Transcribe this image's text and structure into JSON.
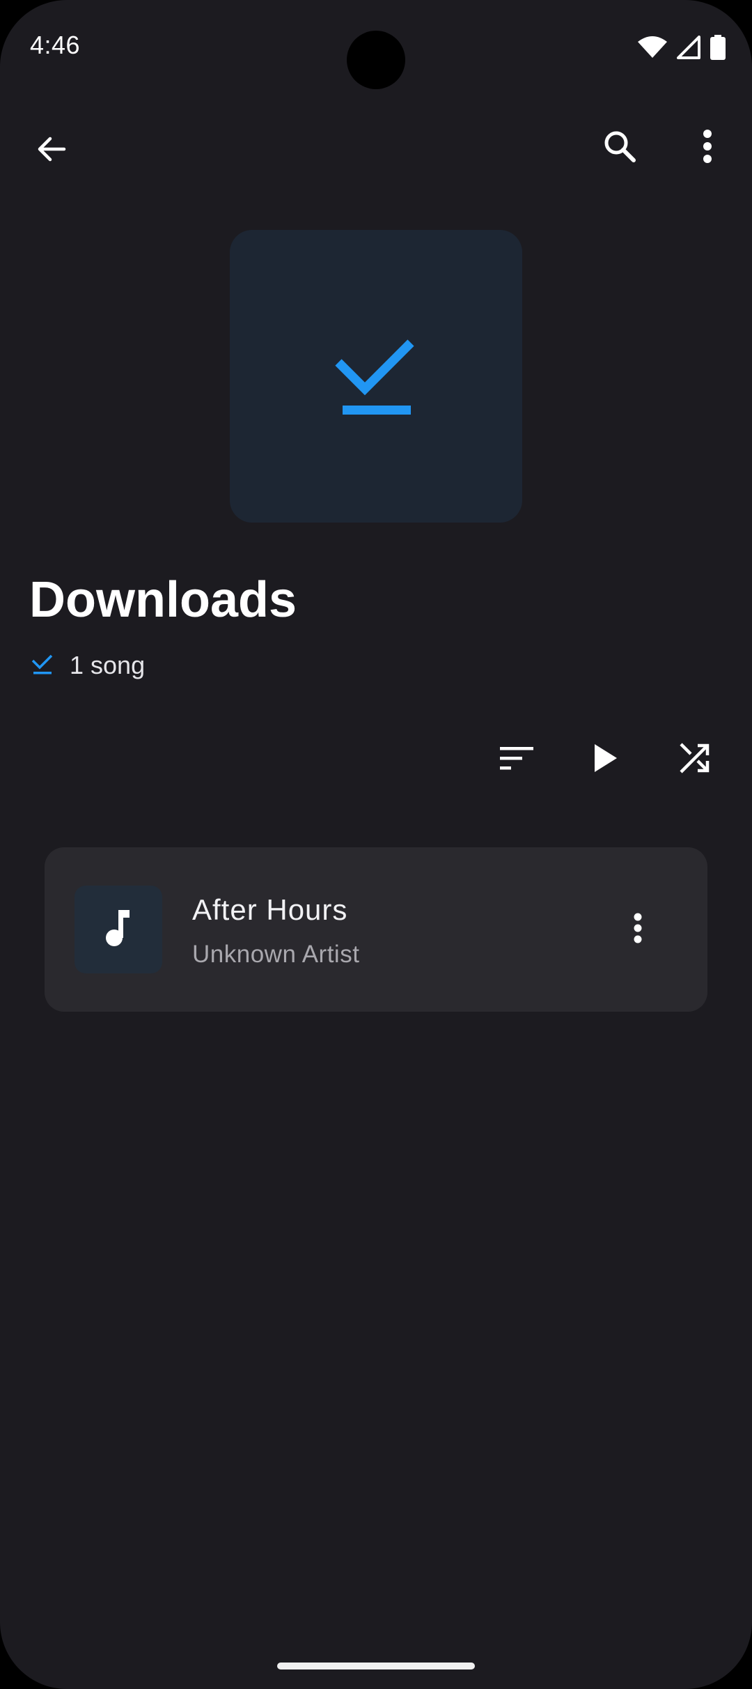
{
  "status_bar": {
    "time": "4:46",
    "icons": [
      "wifi-icon",
      "signal-icon",
      "battery-icon"
    ]
  },
  "toolbar": {
    "back_icon": "arrow-back-icon",
    "search_icon": "search-icon",
    "more_icon": "more-vert-icon"
  },
  "playlist": {
    "cover_icon": "download-done-icon",
    "title": "Downloads",
    "meta_icon": "download-done-icon",
    "count": "1 song"
  },
  "actions": {
    "sort_icon": "sort-icon",
    "play_icon": "play-icon",
    "shuffle_icon": "shuffle-icon"
  },
  "songs": [
    {
      "title": "After Hours",
      "artist": "Unknown Artist",
      "thumb_icon": "music-note-icon"
    }
  ],
  "colors": {
    "background": "#1c1b20",
    "accent": "#2196f3",
    "card": "#2a292e",
    "cover_bg": "#1d2633"
  }
}
